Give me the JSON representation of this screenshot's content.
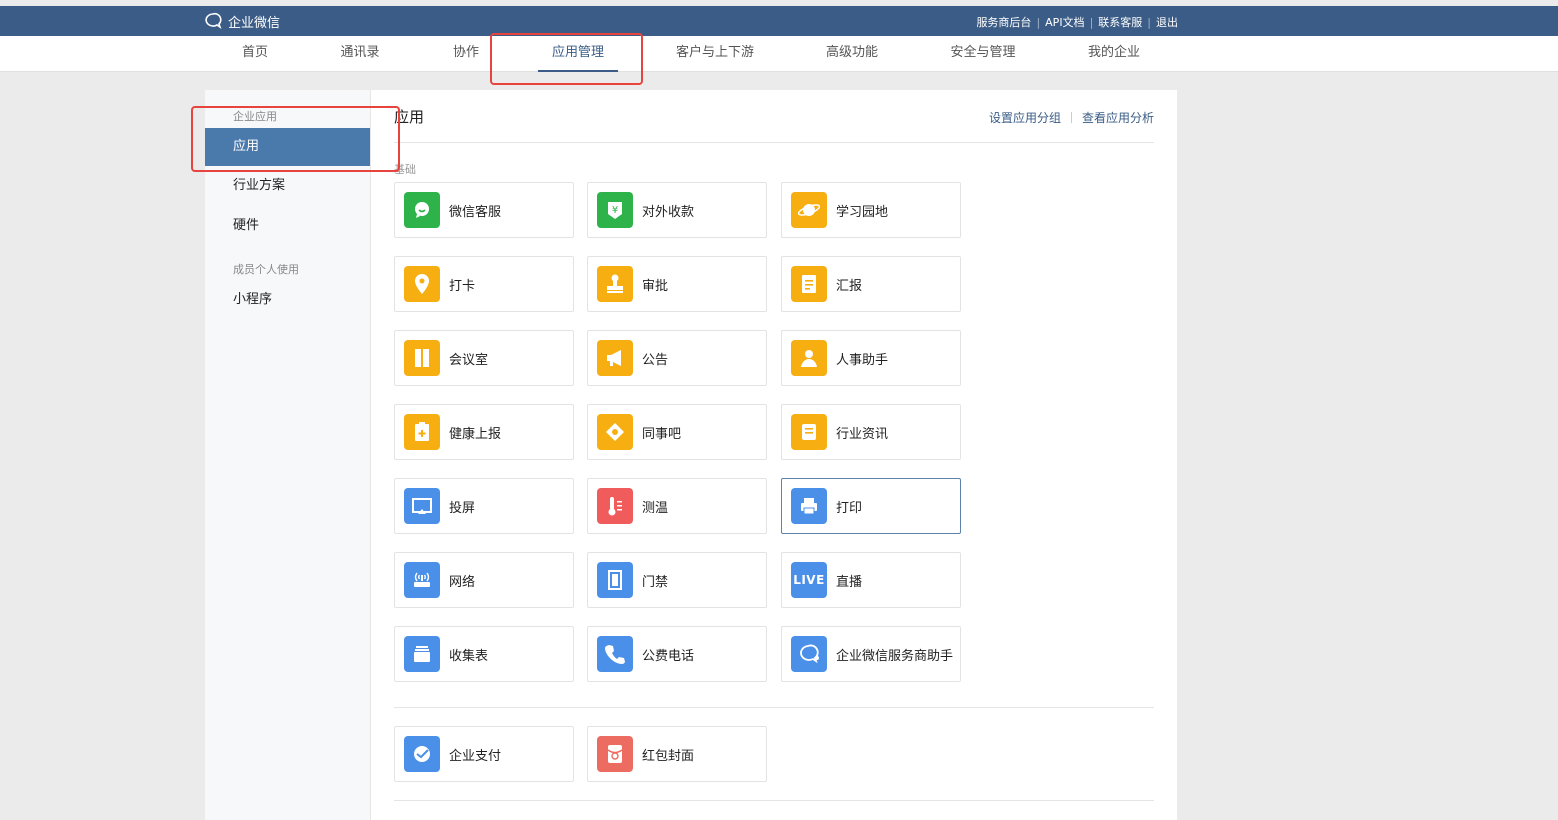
{
  "topbar": {
    "logo_text": "企业微信",
    "links": [
      "服务商后台",
      "API文档",
      "联系客服",
      "退出"
    ]
  },
  "nav": {
    "items": [
      "首页",
      "通讯录",
      "协作",
      "应用管理",
      "客户与上下游",
      "高级功能",
      "安全与管理",
      "我的企业"
    ],
    "active_index": 3
  },
  "sidebar": {
    "caption_1": "企业应用",
    "items_1": [
      "应用",
      "行业方案",
      "硬件"
    ],
    "caption_2": "成员个人使用",
    "items_2": [
      "小程序"
    ],
    "active": "应用"
  },
  "main": {
    "title": "应用",
    "actions": [
      "设置应用分组",
      "查看应用分析"
    ],
    "section_caption": "基础",
    "apps": [
      {
        "label": "微信客服",
        "icon": "wechat-service-icon",
        "color": "#2db34a"
      },
      {
        "label": "对外收款",
        "icon": "payment-collect-icon",
        "color": "#2db34a"
      },
      {
        "label": "学习园地",
        "icon": "learning-planet-icon",
        "color": "#f6ae10"
      },
      {
        "label": "打卡",
        "icon": "location-pin-icon",
        "color": "#f6ae10"
      },
      {
        "label": "审批",
        "icon": "stamp-icon",
        "color": "#f6ae10"
      },
      {
        "label": "汇报",
        "icon": "report-doc-icon",
        "color": "#f6ae10"
      },
      {
        "label": "会议室",
        "icon": "door-icon",
        "color": "#f6ae10"
      },
      {
        "label": "公告",
        "icon": "megaphone-icon",
        "color": "#f6ae10"
      },
      {
        "label": "人事助手",
        "icon": "person-icon",
        "color": "#f6ae10"
      },
      {
        "label": "健康上报",
        "icon": "health-clipboard-icon",
        "color": "#f6ae10"
      },
      {
        "label": "同事吧",
        "icon": "colleague-diamond-icon",
        "color": "#f6ae10"
      },
      {
        "label": "行业资讯",
        "icon": "news-scroll-icon",
        "color": "#f6ae10"
      },
      {
        "label": "投屏",
        "icon": "screen-cast-icon",
        "color": "#4a8fe8"
      },
      {
        "label": "测温",
        "icon": "thermometer-icon",
        "color": "#f05b5b"
      },
      {
        "label": "打印",
        "icon": "printer-icon",
        "color": "#4a8fe8"
      },
      {
        "label": "网络",
        "icon": "router-icon",
        "color": "#4a8fe8"
      },
      {
        "label": "门禁",
        "icon": "access-door-icon",
        "color": "#4a8fe8"
      },
      {
        "label": "直播",
        "icon": "live-icon",
        "color": "#4a8fe8"
      },
      {
        "label": "收集表",
        "icon": "form-stack-icon",
        "color": "#4a8fe8"
      },
      {
        "label": "公费电话",
        "icon": "phone-icon",
        "color": "#4a8fe8"
      },
      {
        "label": "企业微信服务商助手",
        "icon": "wework-assistant-icon",
        "color": "#4a8fe8"
      }
    ],
    "extra_apps": [
      {
        "label": "企业支付",
        "icon": "enterprise-pay-icon",
        "color": "#4a8fe8"
      },
      {
        "label": "红包封面",
        "icon": "red-packet-icon",
        "color": "#ec6c61"
      }
    ],
    "live_badge_text": "LIVE"
  }
}
